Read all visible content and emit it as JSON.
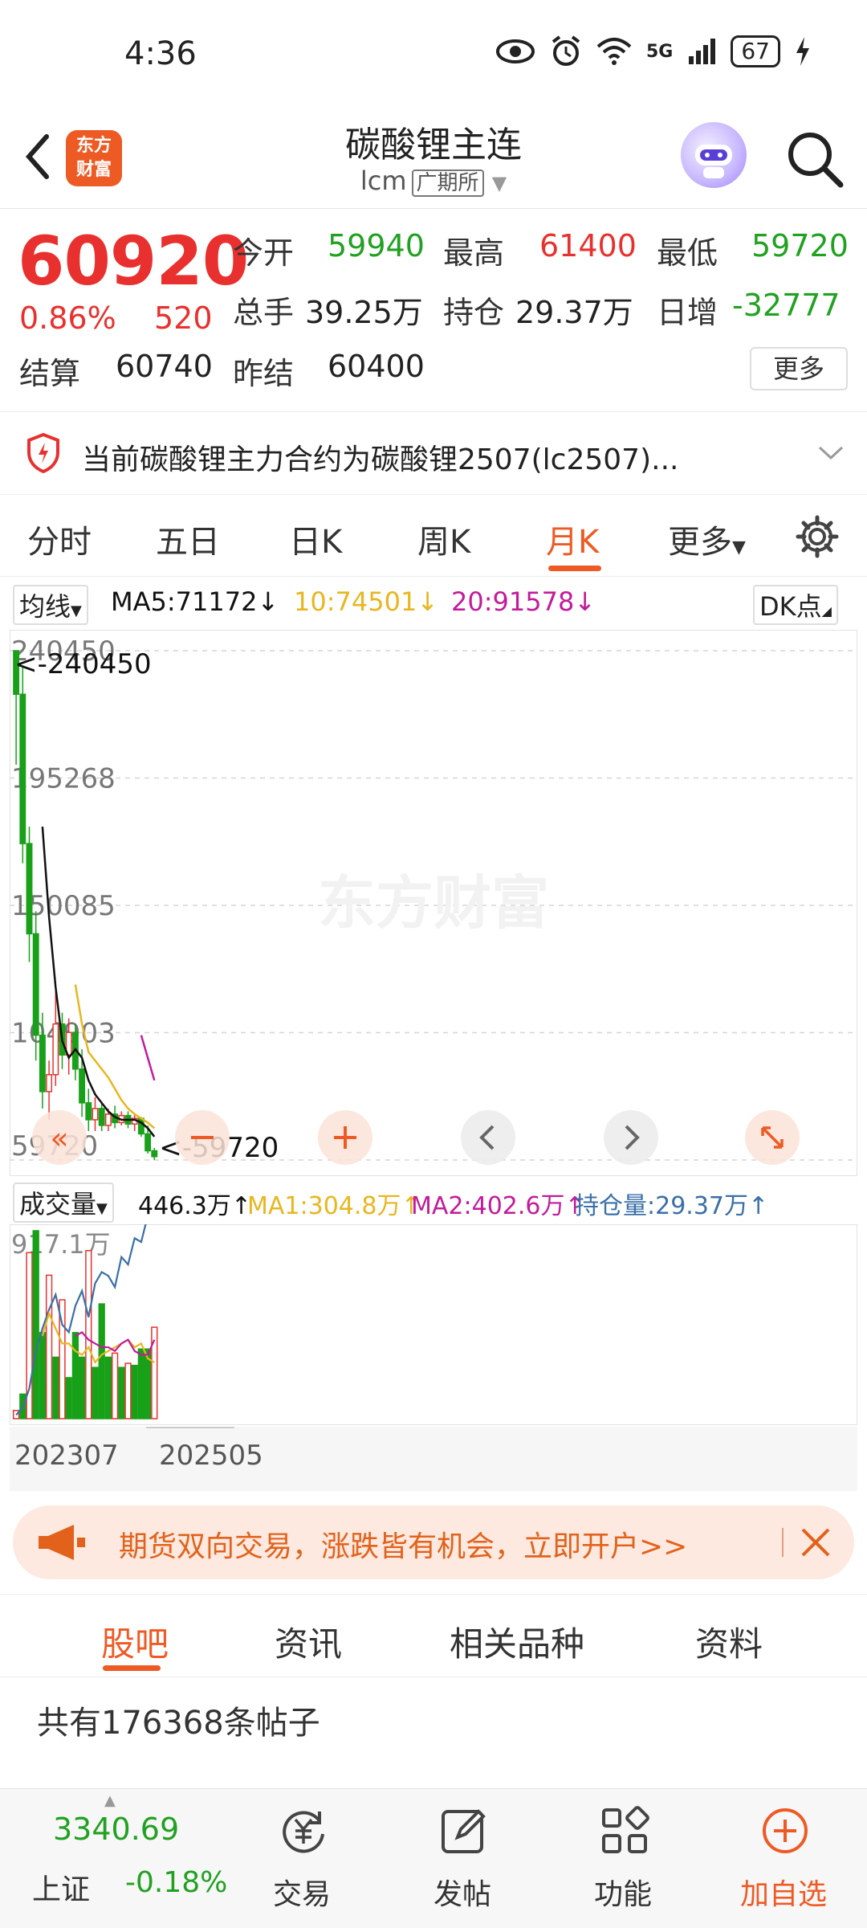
{
  "status_bar": {
    "time": "4:36",
    "battery": "67",
    "network": "5G"
  },
  "header": {
    "title": "碳酸锂主连",
    "code": "lcm",
    "exchange": "广期所",
    "logo_text": [
      "东方",
      "财富"
    ]
  },
  "quote": {
    "last_price": "60920",
    "change_pct": "0.86%",
    "change": "520",
    "open_label": "今开",
    "open": "59940",
    "high_label": "最高",
    "high": "61400",
    "low_label": "最低",
    "low": "59720",
    "volume_label": "总手",
    "volume": "39.25万",
    "oi_label": "持仓",
    "oi": "29.37万",
    "oi_change_label": "日增",
    "oi_change": "-32777",
    "settle_label": "结算",
    "settle": "60740",
    "prev_settle_label": "昨结",
    "prev_settle": "60400",
    "more_label": "更多"
  },
  "notice": {
    "text": "当前碳酸锂主力合约为碳酸锂2507(lc2507)..."
  },
  "chart_tabs": {
    "items": [
      "分时",
      "五日",
      "日K",
      "周K",
      "月K",
      "更多"
    ],
    "active": "月K"
  },
  "indicators": {
    "selector": "均线",
    "ma5": "MA5:71172↓",
    "ma10": "10:74501↓",
    "ma20": "20:91578↓",
    "dk": "DK点",
    "colors": {
      "ma5": "#111111",
      "ma10": "#e8b620",
      "ma20": "#c21b9c"
    }
  },
  "chart_data": [
    {
      "type": "candlestick",
      "period": "monthly",
      "y_ticks": [
        "240450",
        "195268",
        "150085",
        "104903",
        "59720"
      ],
      "ylim": [
        59720,
        240450
      ],
      "max_marker": "<-240450",
      "min_marker": "<-59720",
      "watermark": "东方财富",
      "candles": [
        {
          "o": 240450,
          "h": 240450,
          "l": 200000,
          "c": 225000
        },
        {
          "o": 225000,
          "h": 235000,
          "l": 165000,
          "c": 172000
        },
        {
          "o": 172000,
          "h": 178000,
          "l": 130000,
          "c": 140000
        },
        {
          "o": 140000,
          "h": 148000,
          "l": 95000,
          "c": 104000
        },
        {
          "o": 104000,
          "h": 112000,
          "l": 78000,
          "c": 84000
        },
        {
          "o": 84000,
          "h": 95000,
          "l": 74000,
          "c": 90000
        },
        {
          "o": 90000,
          "h": 120000,
          "l": 86000,
          "c": 108000
        },
        {
          "o": 108000,
          "h": 112000,
          "l": 92000,
          "c": 97000
        },
        {
          "o": 97000,
          "h": 110000,
          "l": 90000,
          "c": 105000
        },
        {
          "o": 105000,
          "h": 108000,
          "l": 88000,
          "c": 92000
        },
        {
          "o": 92000,
          "h": 99000,
          "l": 75000,
          "c": 80000
        },
        {
          "o": 80000,
          "h": 85000,
          "l": 70000,
          "c": 74000
        },
        {
          "o": 74000,
          "h": 82000,
          "l": 70000,
          "c": 78000
        },
        {
          "o": 78000,
          "h": 80000,
          "l": 70000,
          "c": 72000
        },
        {
          "o": 72000,
          "h": 78000,
          "l": 70000,
          "c": 76000
        },
        {
          "o": 76000,
          "h": 79000,
          "l": 71000,
          "c": 73000
        },
        {
          "o": 73000,
          "h": 77000,
          "l": 72000,
          "c": 75500
        },
        {
          "o": 75500,
          "h": 77000,
          "l": 71000,
          "c": 72500
        },
        {
          "o": 72500,
          "h": 76000,
          "l": 70000,
          "c": 74500
        },
        {
          "o": 74500,
          "h": 75000,
          "l": 68000,
          "c": 69000
        },
        {
          "o": 69000,
          "h": 72000,
          "l": 62000,
          "c": 63000
        },
        {
          "o": 63000,
          "h": 64000,
          "l": 59720,
          "c": 60920
        }
      ],
      "ma5": [
        null,
        null,
        null,
        null,
        178000,
        146000,
        121000,
        102000,
        96000,
        99000,
        96000,
        88000,
        83000,
        80000,
        77000,
        75000,
        74000,
        74000,
        74000,
        73000,
        71000,
        68000
      ],
      "ma10": [
        null,
        null,
        null,
        null,
        null,
        null,
        null,
        null,
        null,
        122000,
        108000,
        98000,
        95000,
        92000,
        89000,
        85000,
        81000,
        78000,
        76000,
        74500,
        73000,
        71000
      ],
      "ma20": [
        null,
        null,
        null,
        null,
        null,
        null,
        null,
        null,
        null,
        null,
        null,
        null,
        null,
        null,
        null,
        null,
        null,
        null,
        null,
        104000,
        96000,
        88000
      ]
    },
    {
      "type": "bar",
      "title": "成交量",
      "current": "446.3万↑",
      "ma1": "MA1:304.8万↑",
      "ma2": "MA2:402.6万↑",
      "oi": "持仓量:29.37万↑",
      "y_max_label": "917.1万",
      "ylim": [
        0,
        917.1
      ],
      "colors": {
        "ma1": "#e8b620",
        "ma2": "#c21b9c",
        "oi": "#3a6fa8"
      },
      "values": [
        40,
        120,
        810,
        917,
        420,
        700,
        300,
        580,
        200,
        420,
        300,
        820,
        250,
        560,
        300,
        320,
        250,
        270,
        260,
        340,
        340,
        446.3
      ],
      "up": [
        true,
        false,
        true,
        false,
        false,
        true,
        false,
        true,
        false,
        false,
        false,
        true,
        false,
        false,
        false,
        true,
        false,
        true,
        false,
        false,
        false,
        true
      ],
      "oi_line": [
        0.02,
        0.06,
        0.16,
        0.36,
        0.48,
        0.58,
        0.66,
        0.5,
        0.46,
        0.6,
        0.68,
        0.54,
        0.72,
        0.78,
        0.76,
        0.7,
        0.86,
        0.82,
        0.96,
        0.94,
        1.08,
        1.18
      ],
      "ma_line_1": [
        null,
        null,
        null,
        null,
        0.44,
        0.56,
        0.48,
        0.4,
        0.4,
        0.36,
        0.34,
        0.38,
        0.3,
        0.34,
        0.36,
        0.38,
        0.4,
        0.42,
        0.38,
        0.4,
        0.32,
        0.3
      ],
      "ma_line_2": [
        null,
        null,
        null,
        null,
        null,
        null,
        null,
        null,
        null,
        0.44,
        0.46,
        0.42,
        0.4,
        0.38,
        0.38,
        0.36,
        0.4,
        0.42,
        0.36,
        0.34,
        0.34,
        0.42
      ]
    }
  ],
  "date_labels": [
    "202307",
    "202505"
  ],
  "ad": {
    "text": "期货双向交易，涨跌皆有机会，立即开户>>"
  },
  "community_tabs": {
    "items": [
      "股吧",
      "资讯",
      "相关品种",
      "资料"
    ],
    "active": "股吧"
  },
  "post_count": "共有176368条帖子",
  "bottom_bar": {
    "index_value": "3340.69",
    "index_name": "上证",
    "index_change": "-0.18%",
    "trade": "交易",
    "post": "发帖",
    "functions": "功能",
    "add_watch": "加自选"
  }
}
